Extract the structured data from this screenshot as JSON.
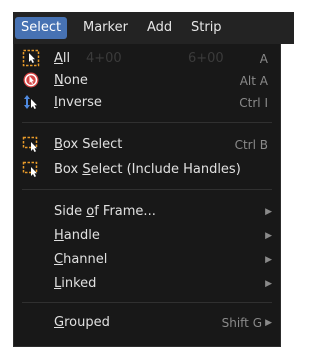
{
  "menubar": {
    "items": [
      {
        "label": "Select",
        "active": true
      },
      {
        "label": "Marker"
      },
      {
        "label": "Add"
      },
      {
        "label": "Strip"
      }
    ]
  },
  "menu": {
    "all": {
      "label_pre": "",
      "label_u": "A",
      "label_post": "ll",
      "shortcut": "A",
      "icon": "select-all-icon",
      "ghost_left": "4+00",
      "ghost_right": "6+00"
    },
    "none": {
      "label_pre": "",
      "label_u": "N",
      "label_post": "one",
      "shortcut": "Alt A",
      "icon": "select-none-icon"
    },
    "inverse": {
      "label_pre": "",
      "label_u": "I",
      "label_post": "nverse",
      "shortcut": "Ctrl I",
      "icon": "select-inverse-icon"
    },
    "box_select": {
      "label_pre": "",
      "label_u": "B",
      "label_post": "ox Select",
      "shortcut": "Ctrl B",
      "icon": "box-select-icon"
    },
    "box_select_handles": {
      "label_pre": "Box ",
      "label_u": "S",
      "label_post": "elect (Include Handles)",
      "shortcut": "",
      "icon": "box-select-icon"
    },
    "side_of_frame": {
      "label_pre": "Side ",
      "label_u": "o",
      "label_post": "f Frame...",
      "arrow": "▶"
    },
    "handle": {
      "label_pre": "",
      "label_u": "H",
      "label_post": "andle",
      "arrow": "▶"
    },
    "channel": {
      "label_pre": "",
      "label_u": "C",
      "label_post": "hannel",
      "arrow": "▶"
    },
    "linked": {
      "label_pre": "",
      "label_u": "L",
      "label_post": "inked",
      "arrow": "▶"
    },
    "grouped": {
      "label_pre": "",
      "label_u": "G",
      "label_post": "rouped",
      "shortcut": "Shift G",
      "arrow": "▶"
    }
  },
  "colors": {
    "accent": "#4772b3",
    "panel_bg": "#181818",
    "icon_orange": "#e69a2a",
    "icon_red": "#d64545",
    "icon_blue": "#4f8ae0"
  }
}
